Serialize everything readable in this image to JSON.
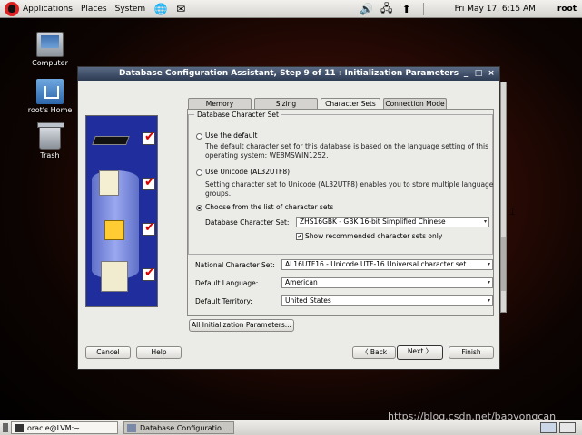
{
  "top_panel": {
    "menus": [
      "Applications",
      "Places",
      "System"
    ],
    "clock": "Fri May 17,  6:15 AM",
    "user": "root"
  },
  "desktop": {
    "icons": [
      "Computer",
      "root's Home",
      "Trash"
    ]
  },
  "dialog": {
    "title": "Database Configuration Assistant, Step 9 of 11 : Initialization Parameters",
    "tabs": [
      "Memory",
      "Sizing",
      "Character Sets",
      "Connection Mode"
    ],
    "active_tab": "Character Sets",
    "group_title": "Database Character Set",
    "option_default": {
      "label": "Use the default",
      "desc_line1": "The default character set for this database is based on the language setting of this",
      "desc_line2": "operating system: WE8MSWIN1252."
    },
    "option_unicode": {
      "label": "Use Unicode (AL32UTF8)",
      "desc_line1": "Setting character set to Unicode (AL32UTF8) enables you to store multiple language",
      "desc_line2": "groups."
    },
    "option_list": {
      "label": "Choose from the list of character sets"
    },
    "db_charset_label": "Database Character Set:",
    "db_charset_value": "ZHS16GBK - GBK 16-bit Simplified Chinese",
    "show_recommended_label": "Show recommended character sets only",
    "national_charset_label": "National Character Set:",
    "national_charset_value": "AL16UTF16 - Unicode UTF-16 Universal character set",
    "default_language_label": "Default Language:",
    "default_language_value": "American",
    "default_territory_label": "Default Territory:",
    "default_territory_value": "United States",
    "all_params_button": "All Initialization Parameters...",
    "buttons": {
      "cancel": "Cancel",
      "help": "Help",
      "back": "Back",
      "next": "Next",
      "finish": "Finish"
    }
  },
  "taskbar": {
    "tasks": [
      "oracle@LVM:~",
      "Database Configuratio..."
    ]
  },
  "watermark": "https://blog.csdn.net/baoyongcan"
}
